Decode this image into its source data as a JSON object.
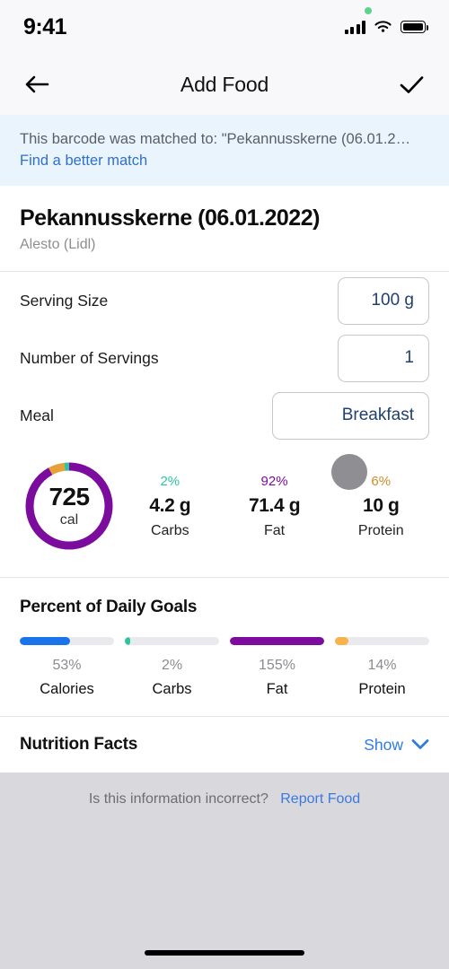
{
  "status_bar": {
    "time": "9:41",
    "moon_icon": "moon-icon",
    "cellular_icon": "cellular-signal-icon",
    "wifi_icon": "wifi-icon",
    "battery_icon": "battery-full-icon",
    "recording_dot": "green-recording-dot"
  },
  "nav": {
    "back_icon": "arrow-left-icon",
    "title": "Add Food",
    "confirm_icon": "checkmark-icon"
  },
  "banner": {
    "message": "This barcode was matched to: \"Pekannusskerne (06.01.2…",
    "link": "Find a better match"
  },
  "food": {
    "title": "Pekannusskerne (06.01.2022)",
    "brand": "Alesto (Lidl)"
  },
  "form": {
    "serving_size": {
      "label": "Serving Size",
      "value": "100 g"
    },
    "number_of_servings": {
      "label": "Number of Servings",
      "value": "1"
    },
    "meal": {
      "label": "Meal",
      "value": "Breakfast"
    }
  },
  "summary": {
    "calories": "725",
    "calories_unit": "cal",
    "macros": [
      {
        "percent": "2%",
        "value": "4.2 g",
        "name": "Carbs",
        "color": "#2ec4a0"
      },
      {
        "percent": "92%",
        "value": "71.4 g",
        "name": "Fat",
        "color": "#7b0c9e"
      },
      {
        "percent": "6%",
        "value": "10 g",
        "name": "Protein",
        "color": "#e8a13a"
      }
    ]
  },
  "daily_goals": {
    "heading": "Percent of Daily Goals",
    "items": [
      {
        "name": "Calories",
        "percent": "53%",
        "fill": 53,
        "color": "#1a73e8"
      },
      {
        "name": "Carbs",
        "percent": "2%",
        "fill": 6,
        "color": "#2ec4a0"
      },
      {
        "name": "Fat",
        "percent": "155%",
        "fill": 100,
        "color": "#7b0c9e"
      },
      {
        "name": "Protein",
        "percent": "14%",
        "fill": 14,
        "color": "#f7b24a"
      }
    ]
  },
  "nutrition_facts": {
    "title": "Nutrition Facts",
    "toggle_label": "Show",
    "chevron_icon": "chevron-down-icon"
  },
  "footer": {
    "question": "Is this information incorrect?",
    "link": "Report Food"
  },
  "chart_data": {
    "type": "pie",
    "title": "Calorie breakdown by macronutrient",
    "categories": [
      "Carbs",
      "Fat",
      "Protein"
    ],
    "values": [
      2,
      92,
      6
    ],
    "grams": [
      4.2,
      71.4,
      10
    ],
    "colors": [
      "#2ec4a0",
      "#7b0c9e",
      "#e8a13a"
    ],
    "total_calories": 725,
    "unit": "%",
    "legend": "inline-below"
  }
}
